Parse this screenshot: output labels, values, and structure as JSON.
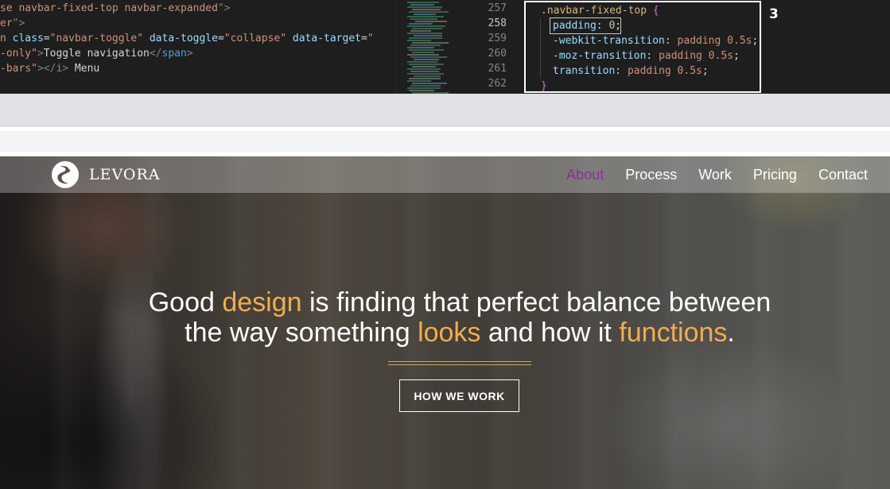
{
  "editor": {
    "left_code": [
      {
        "parts": [
          {
            "t": "se navbar-fixed-top navbar-expanded",
            "c": "str"
          },
          {
            "t": "\">",
            "c": "punc"
          }
        ]
      },
      {
        "parts": [
          {
            "t": "er",
            "c": "str"
          },
          {
            "t": "\">",
            "c": "punc"
          }
        ]
      },
      {
        "parts": [
          {
            "t": "n ",
            "c": "str"
          },
          {
            "t": "class",
            "c": "attr"
          },
          {
            "t": "=",
            "c": "text"
          },
          {
            "t": "\"navbar-toggle\"",
            "c": "str"
          },
          {
            "t": " ",
            "c": "text"
          },
          {
            "t": "data-toggle",
            "c": "attr"
          },
          {
            "t": "=",
            "c": "text"
          },
          {
            "t": "\"collapse\"",
            "c": "str"
          },
          {
            "t": " ",
            "c": "text"
          },
          {
            "t": "data-target",
            "c": "attr"
          },
          {
            "t": "=",
            "c": "text"
          },
          {
            "t": "\"",
            "c": "str"
          }
        ]
      },
      {
        "parts": [
          {
            "t": "-only\"",
            "c": "str"
          },
          {
            "t": ">",
            "c": "punc"
          },
          {
            "t": "Toggle navigation",
            "c": "text"
          },
          {
            "t": "</",
            "c": "punc"
          },
          {
            "t": "span",
            "c": "tag"
          },
          {
            "t": ">",
            "c": "punc"
          }
        ]
      },
      {
        "parts": [
          {
            "t": "-bars\"",
            "c": "str"
          },
          {
            "t": "></",
            "c": "punc"
          },
          {
            "t": "i",
            "c": "tag"
          },
          {
            "t": ">",
            "c": "punc"
          },
          {
            "t": " Menu",
            "c": "text"
          }
        ]
      }
    ],
    "line_numbers": [
      "257",
      "258",
      "259",
      "260",
      "261",
      "262"
    ],
    "current_line": "258",
    "right_code": {
      "selector": ".navbar-fixed-top",
      "open_brace": "{",
      "close_brace": "}",
      "declarations": [
        {
          "prop": "padding",
          "value": "0",
          "sep": ": ",
          "end": ";"
        },
        {
          "prop": "-webkit-transition",
          "value": "padding 0.5s",
          "sep": ": ",
          "end": ";"
        },
        {
          "prop": "-moz-transition",
          "value": "padding 0.5s",
          "sep": ": ",
          "end": ";"
        },
        {
          "prop": "transition",
          "value": "padding 0.5s",
          "sep": ": ",
          "end": ";"
        }
      ]
    },
    "step_number": "3"
  },
  "site": {
    "brand": "LEVORA",
    "nav": [
      "About",
      "Process",
      "Work",
      "Pricing",
      "Contact"
    ],
    "active_nav": "About",
    "headline": {
      "line1": [
        {
          "t": "Good ",
          "hl": false
        },
        {
          "t": "design",
          "hl": true
        },
        {
          "t": " is finding that perfect balance between",
          "hl": false
        }
      ],
      "line2": [
        {
          "t": "the way something ",
          "hl": false
        },
        {
          "t": "looks",
          "hl": true
        },
        {
          "t": " and how it ",
          "hl": false
        },
        {
          "t": "functions",
          "hl": true
        },
        {
          "t": ".",
          "hl": false
        }
      ]
    },
    "cta_label": "HOW WE WORK"
  },
  "colors": {
    "accent_text": "#f0ad4e",
    "active_nav": "#8b2fa0",
    "editor_bg": "#1e1e1e"
  }
}
